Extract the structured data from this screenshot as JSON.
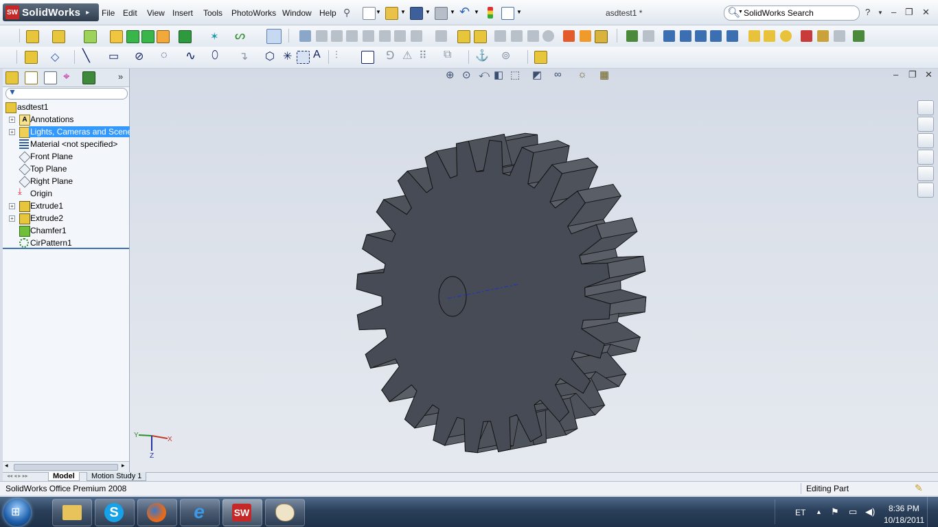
{
  "app": {
    "logo_text": "SolidWorks",
    "logo_badge": "SW",
    "document_title": "asdtest1 *",
    "search_placeholder": "SolidWorks Search"
  },
  "menu": [
    "File",
    "Edit",
    "View",
    "Insert",
    "Tools",
    "PhotoWorks",
    "Window",
    "Help"
  ],
  "feature_tree": {
    "root": "asdtest1",
    "items": [
      {
        "label": "Annotations",
        "icon": "annotations-icon",
        "expandable": true
      },
      {
        "label": "Lights, Cameras and Scene",
        "icon": "lights-cameras-icon",
        "expandable": true,
        "selected": true
      },
      {
        "label": "Material <not specified>",
        "icon": "material-icon",
        "expandable": false
      },
      {
        "label": "Front Plane",
        "icon": "plane-icon",
        "expandable": false
      },
      {
        "label": "Top Plane",
        "icon": "plane-icon",
        "expandable": false
      },
      {
        "label": "Right Plane",
        "icon": "plane-icon",
        "expandable": false
      },
      {
        "label": "Origin",
        "icon": "origin-icon",
        "expandable": false
      },
      {
        "label": "Extrude1",
        "icon": "extrude-icon",
        "expandable": true
      },
      {
        "label": "Extrude2",
        "icon": "extrude-icon",
        "expandable": true
      },
      {
        "label": "Chamfer1",
        "icon": "chamfer-icon",
        "expandable": false
      },
      {
        "label": "CirPattern1",
        "icon": "circular-pattern-icon",
        "expandable": false
      }
    ]
  },
  "bottom_tabs": [
    "Model",
    "Motion Study 1"
  ],
  "status": {
    "left": "SolidWorks Office Premium 2008",
    "right": "Editing Part"
  },
  "triad": {
    "x_label": "X",
    "y_label": "Y",
    "z_label": "Z"
  },
  "taskbar": {
    "language": "ET",
    "time": "8:36 PM",
    "date": "10/18/2011",
    "apps": [
      "windows-explorer-icon",
      "skype-icon",
      "firefox-icon",
      "internet-explorer-icon",
      "solidworks-icon",
      "paint-icon"
    ]
  },
  "colors": {
    "gear_face": "#474b55",
    "gear_side": "#55595f",
    "selection": "#3399ff",
    "logo_red": "#c62828"
  }
}
